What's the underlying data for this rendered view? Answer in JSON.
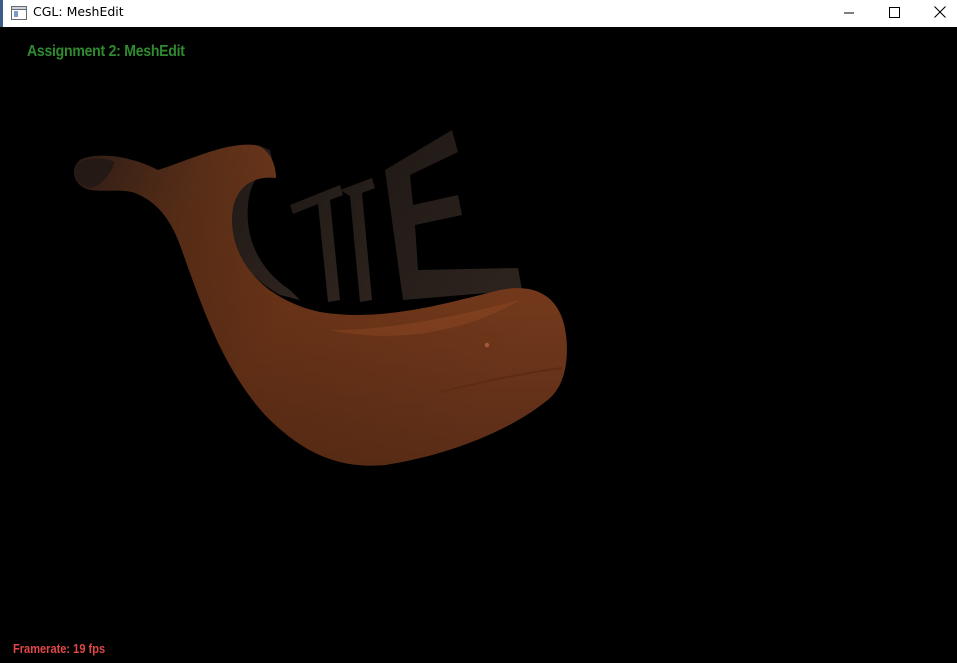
{
  "window": {
    "title": "CGL: MeshEdit"
  },
  "viewport": {
    "heading": "Assignment 2: MeshEdit",
    "framerate_text": "Framerate: 19 fps",
    "heading_color": "#2f8b2f",
    "framerate_color": "#e04848",
    "mesh_color": "#8a4422"
  },
  "icons": {
    "app": "app-window-icon",
    "minimize": "minimize-icon",
    "maximize": "maximize-icon",
    "close": "close-icon"
  }
}
